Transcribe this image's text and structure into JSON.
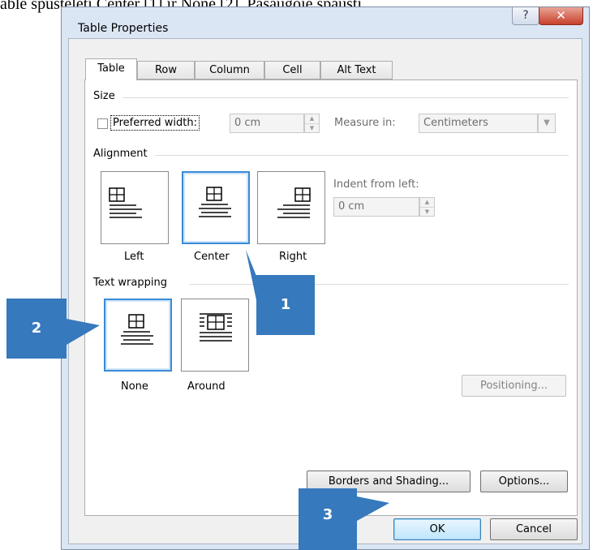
{
  "background_text": "able spustelėti Center [1] ir None [2]. Pasaugoje spausti",
  "dialog": {
    "title": "Table Properties",
    "help_glyph": "?",
    "close_glyph": "✕"
  },
  "tabs": [
    {
      "label": "Table",
      "active": true
    },
    {
      "label": "Row",
      "active": false
    },
    {
      "label": "Column",
      "active": false
    },
    {
      "label": "Cell",
      "active": false
    },
    {
      "label": "Alt Text",
      "active": false
    }
  ],
  "size": {
    "group_label": "Size",
    "preferred_width_label": "Preferred width:",
    "preferred_width_checked": false,
    "width_value": "0 cm",
    "measure_in_label": "Measure in:",
    "measure_in_value": "Centimeters"
  },
  "alignment": {
    "group_label": "Alignment",
    "options": [
      {
        "label": "Left",
        "selected": false
      },
      {
        "label": "Center",
        "selected": true
      },
      {
        "label": "Right",
        "selected": false
      }
    ],
    "indent_label": "Indent from left:",
    "indent_value": "0 cm"
  },
  "text_wrapping": {
    "group_label": "Text wrapping",
    "options": [
      {
        "label": "None",
        "selected": true
      },
      {
        "label": "Around",
        "selected": false
      }
    ],
    "positioning_button": "Positioning..."
  },
  "buttons": {
    "borders_shading": "Borders and Shading...",
    "options": "Options...",
    "ok": "OK",
    "cancel": "Cancel"
  },
  "callouts": [
    {
      "number": "1",
      "target": "Center"
    },
    {
      "number": "2",
      "target": "None"
    },
    {
      "number": "3",
      "target": "OK"
    }
  ],
  "colors": {
    "callout": "#3679bd",
    "selection_border": "#3a8ad6"
  }
}
